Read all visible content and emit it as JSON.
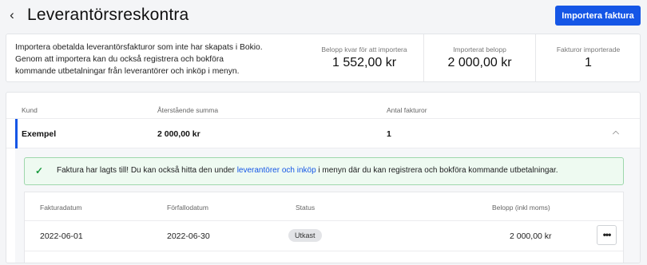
{
  "header": {
    "back_icon": "chevron-left-icon",
    "title": "Leverantörsreskontra",
    "import_button": "Importera faktura"
  },
  "summary": {
    "description": "Importera obetalda leverantörsfakturor som inte har skapats i Bokio. Genom att importera kan du också registrera och bokföra kommande utbetalningar från leverantörer och inköp i menyn.",
    "stats": [
      {
        "label": "Belopp kvar för att importera",
        "value": "1 552,00 kr"
      },
      {
        "label": "Importerat belopp",
        "value": "2 000,00 kr"
      },
      {
        "label": "Fakturor importerade",
        "value": "1"
      }
    ]
  },
  "list": {
    "columns": {
      "customer": "Kund",
      "remaining": "Återstående summa",
      "count": "Antal fakturor"
    },
    "group": {
      "customer": "Exempel",
      "remaining": "2 000,00 kr",
      "count": "1",
      "expanded": true
    },
    "success": {
      "icon": "check-icon",
      "text_before": "Faktura har lagts till! Du kan också hitta den under ",
      "link": "leverantörer och inköp",
      "text_after": " i menyn där du kan registrera och bokföra kommande utbetalningar."
    },
    "invoice_columns": {
      "invoice_date": "Fakturadatum",
      "due_date": "Förfallodatum",
      "status": "Status",
      "amount": "Belopp (inkl moms)"
    },
    "invoices": [
      {
        "invoice_date": "2022-06-01",
        "due_date": "2022-06-30",
        "status": "Utkast",
        "amount": "2 000,00 kr"
      }
    ]
  },
  "colors": {
    "accent": "#1556e6",
    "success_border": "#9ed7ac",
    "success_bg": "#eefaf1",
    "check": "#1a9a3f"
  }
}
